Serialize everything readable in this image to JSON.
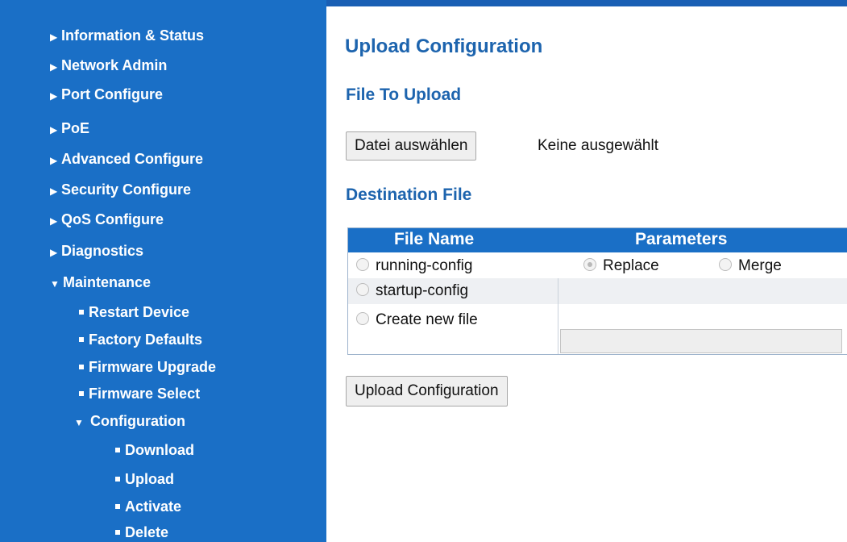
{
  "sidebar": {
    "top_items": [
      {
        "label": "Information & Status"
      },
      {
        "label": "Network Admin"
      },
      {
        "label": "Port Configure"
      },
      {
        "label": "PoE"
      },
      {
        "label": "Advanced Configure"
      },
      {
        "label": "Security Configure"
      },
      {
        "label": "QoS Configure"
      },
      {
        "label": "Diagnostics"
      }
    ],
    "maintenance": {
      "label": "Maintenance",
      "items": [
        {
          "label": "Restart Device"
        },
        {
          "label": "Factory Defaults"
        },
        {
          "label": "Firmware Upgrade"
        },
        {
          "label": "Firmware Select"
        }
      ],
      "configuration": {
        "label": "Configuration",
        "items": [
          {
            "label": "Download"
          },
          {
            "label": "Upload"
          },
          {
            "label": "Activate"
          },
          {
            "label": "Delete"
          }
        ]
      }
    }
  },
  "main": {
    "title": "Upload Configuration",
    "file_section_title": "File To Upload",
    "choose_file_button": "Datei auswählen",
    "file_status": "Keine ausgewählt",
    "destination_title": "Destination File",
    "table": {
      "headers": [
        "File Name",
        "Parameters"
      ],
      "rows": [
        {
          "name": "running-config"
        },
        {
          "name": "startup-config"
        },
        {
          "name": "Create new file"
        }
      ],
      "param_replace": "Replace",
      "param_merge": "Merge"
    },
    "upload_button": "Upload Configuration"
  },
  "colors": {
    "sidebar_bg": "#1a6fc6",
    "heading": "#1d64ae",
    "table_header": "#1a6fc6"
  }
}
